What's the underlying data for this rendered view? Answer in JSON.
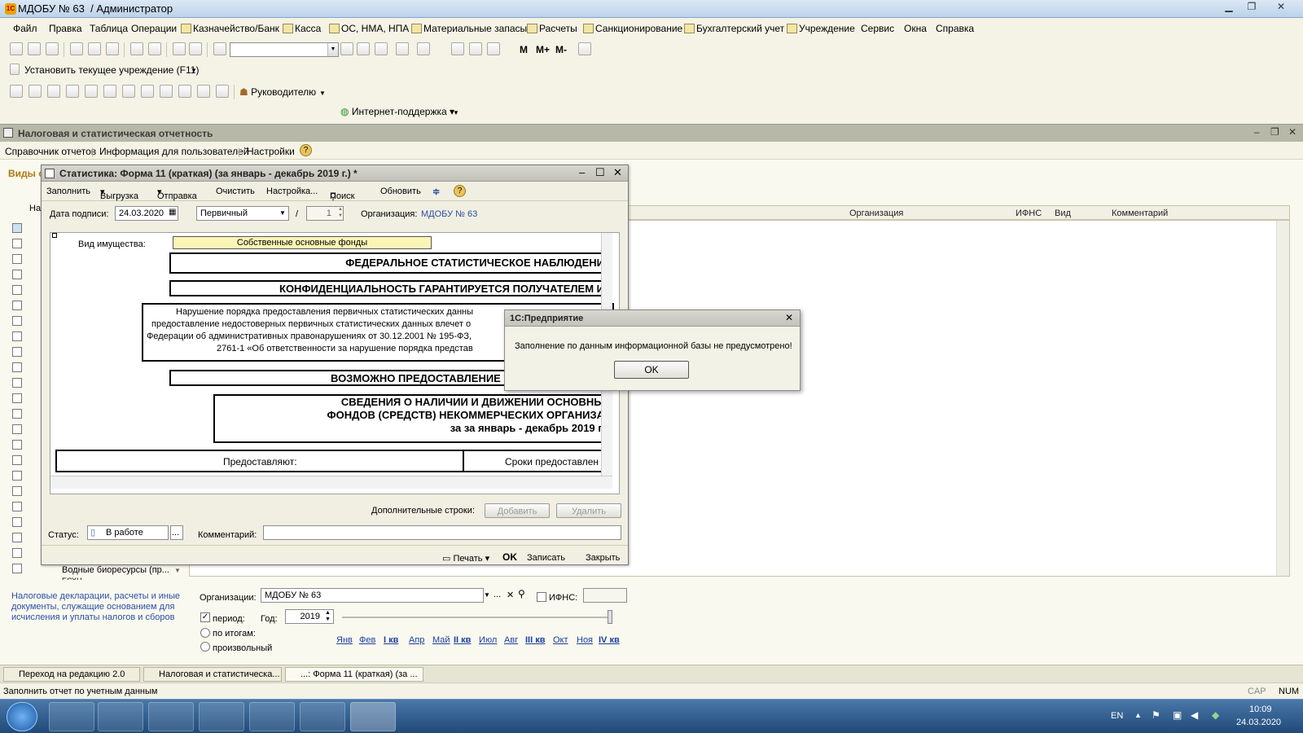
{
  "app": {
    "title": "МДОБУ № 63",
    "user": "/ Администратор",
    "logo": "1С"
  },
  "menu": [
    "Файл",
    "Правка",
    "Таблица",
    "Операции",
    "Казначейство/Банк",
    "Касса",
    "ОС, НМА, НПА",
    "Материальные запасы",
    "Расчеты",
    "Санкционирование",
    "Бухгалтерский учет",
    "Учреждение",
    "Сервис",
    "Окна",
    "Справка"
  ],
  "toolbar": {
    "set_institution": "Установить текущее учреждение (F11)",
    "managers": "Руководителю",
    "internet_support": "Интернет-поддержка",
    "m": "М",
    "m_plus": "М+",
    "m_minus": "М-"
  },
  "mdi": {
    "title": "Налоговая и статистическая отчетность"
  },
  "sublinks": [
    "Справочник отчетов",
    "Информация для пользователей",
    "Настройки"
  ],
  "grid": {
    "side_label": "Виды о",
    "col_name": "На",
    "headers": [
      "Организация",
      "ИФНС",
      "Вид",
      "Комментарий"
    ],
    "bottom_item": "Водные биоресурсы (пр...",
    "bottom_item2": "ЕСХН"
  },
  "report_window": {
    "title": "Статистика: Форма 11 (краткая) (за январь - декабрь 2019 г.) *",
    "actions": [
      "Заполнить",
      "Выгрузка",
      "Отправка",
      "Очистить",
      "Настройка...",
      "Поиск",
      "Обновить"
    ],
    "sign_date_label": "Дата подписи:",
    "sign_date": "24.03.2020",
    "kind": "Первичный",
    "slash": "/",
    "number": "1",
    "org_label": "Организация:",
    "org": "МДОБУ № 63",
    "property_label": "Вид имущества:",
    "property_value": "Собственные основные фонды",
    "sheet": {
      "fed": "ФЕДЕРАЛЬНОЕ СТАТИСТИЧЕСКОЕ НАБЛЮДЕНИ",
      "conf": "КОНФИДЕНЦИАЛЬНОСТЬ ГАРАНТИРУЕТСЯ ПОЛУЧАТЕЛЕМ И",
      "warn1": "Нарушение порядка предоставления первичных статистических данны",
      "warn2": "предоставление недостоверных первичных статистических данных влечет о",
      "warn3": "Федерации об административных правонарушениях от 30.12.2001 № 195-ФЗ,",
      "warn4": "2761-1 «Об ответственности за нарушение порядка представ",
      "possible": "ВОЗМОЖНО ПРЕДОСТАВЛЕНИЕ",
      "info1": "СВЕДЕНИЯ О НАЛИЧИИ И ДВИЖЕНИИ ОСНОВНЫ",
      "info2": "ФОНДОВ (СРЕДСТВ) НЕКОММЕРЧЕСКИХ ОРГАНИЗА",
      "info3": "за  за январь - декабрь 2019 г.",
      "provide": "Предоставляют:",
      "terms": "Сроки предоставлен"
    },
    "extra_rows_label": "Дополнительные строки:",
    "add_btn": "Добавить",
    "del_btn": "Удалить",
    "status_label": "Статус:",
    "status": "В работе",
    "comment_label": "Комментарий:",
    "print": "Печать",
    "ok": "OK",
    "save": "Записать",
    "close": "Закрыть"
  },
  "dialog": {
    "title": "1С:Предприятие",
    "message": "Заполнение по данным информационной базы не предусмотрено!",
    "ok": "OK"
  },
  "filters": {
    "desc": "Налоговые декларации, расчеты и иные документы, служащие основанием для исчисления и уплаты налогов и сборов",
    "org_label": "Организации:",
    "org": "МДОБУ № 63",
    "ifns_label": "ИФНС:",
    "period_label": "период:",
    "year_label": "Год:",
    "year": "2019",
    "by_totals": "по итогам:",
    "arbitrary": "произвольный",
    "months": [
      "Янв",
      "Фев",
      "I кв",
      "Апр",
      "Май",
      "II кв",
      "Июл",
      "Авг",
      "III кв",
      "Окт",
      "Ноя",
      "IV кв"
    ]
  },
  "task_strip": [
    "Переход на редакцию 2.0",
    "Налоговая и статистическа...",
    "...: Форма 11 (краткая) (за ..."
  ],
  "statusbar": {
    "text": "Заполнить отчет по учетным данным",
    "cap": "CAP",
    "num": "NUM"
  },
  "tray": {
    "lang": "EN",
    "time": "10:09",
    "date": "24.03.2020"
  }
}
